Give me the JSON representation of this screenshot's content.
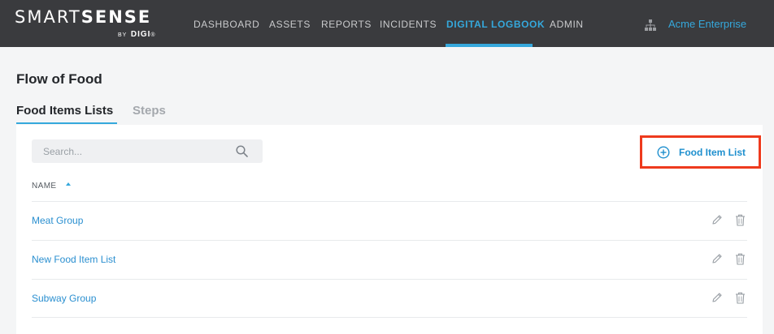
{
  "brand": {
    "main_light": "SMART",
    "main_bold": "SENSE",
    "sub_by": "BY",
    "sub_digi": "DIGI",
    "sub_reg": "®"
  },
  "nav": {
    "items": [
      "DASHBOARD",
      "ASSETS",
      "REPORTS",
      "INCIDENTS",
      "DIGITAL LOGBOOK",
      "ADMIN"
    ],
    "active": "DIGITAL LOGBOOK"
  },
  "org": {
    "icon": "org-hierarchy-icon",
    "name": "Acme Enterprise"
  },
  "page": {
    "title": "Flow of Food"
  },
  "tabs": [
    {
      "label": "Food Items Lists",
      "active": true
    },
    {
      "label": "Steps",
      "active": false
    }
  ],
  "search": {
    "placeholder": "Search...",
    "value": "",
    "icon": "search-icon"
  },
  "add_button": {
    "label": "Food Item List",
    "icon": "plus-circle-icon"
  },
  "table": {
    "column": "NAME",
    "sort": "ascending",
    "rows": [
      {
        "name": "Meat Group"
      },
      {
        "name": "New Food Item List"
      },
      {
        "name": "Subway Group"
      }
    ],
    "row_actions": [
      "pencil-icon",
      "trash-icon"
    ]
  },
  "colors": {
    "topbar": "#3a3b3e",
    "accent": "#35a8dc",
    "link": "#2a8fd0",
    "highlight_border": "#ee3a1d",
    "background": "#f4f5f6"
  }
}
